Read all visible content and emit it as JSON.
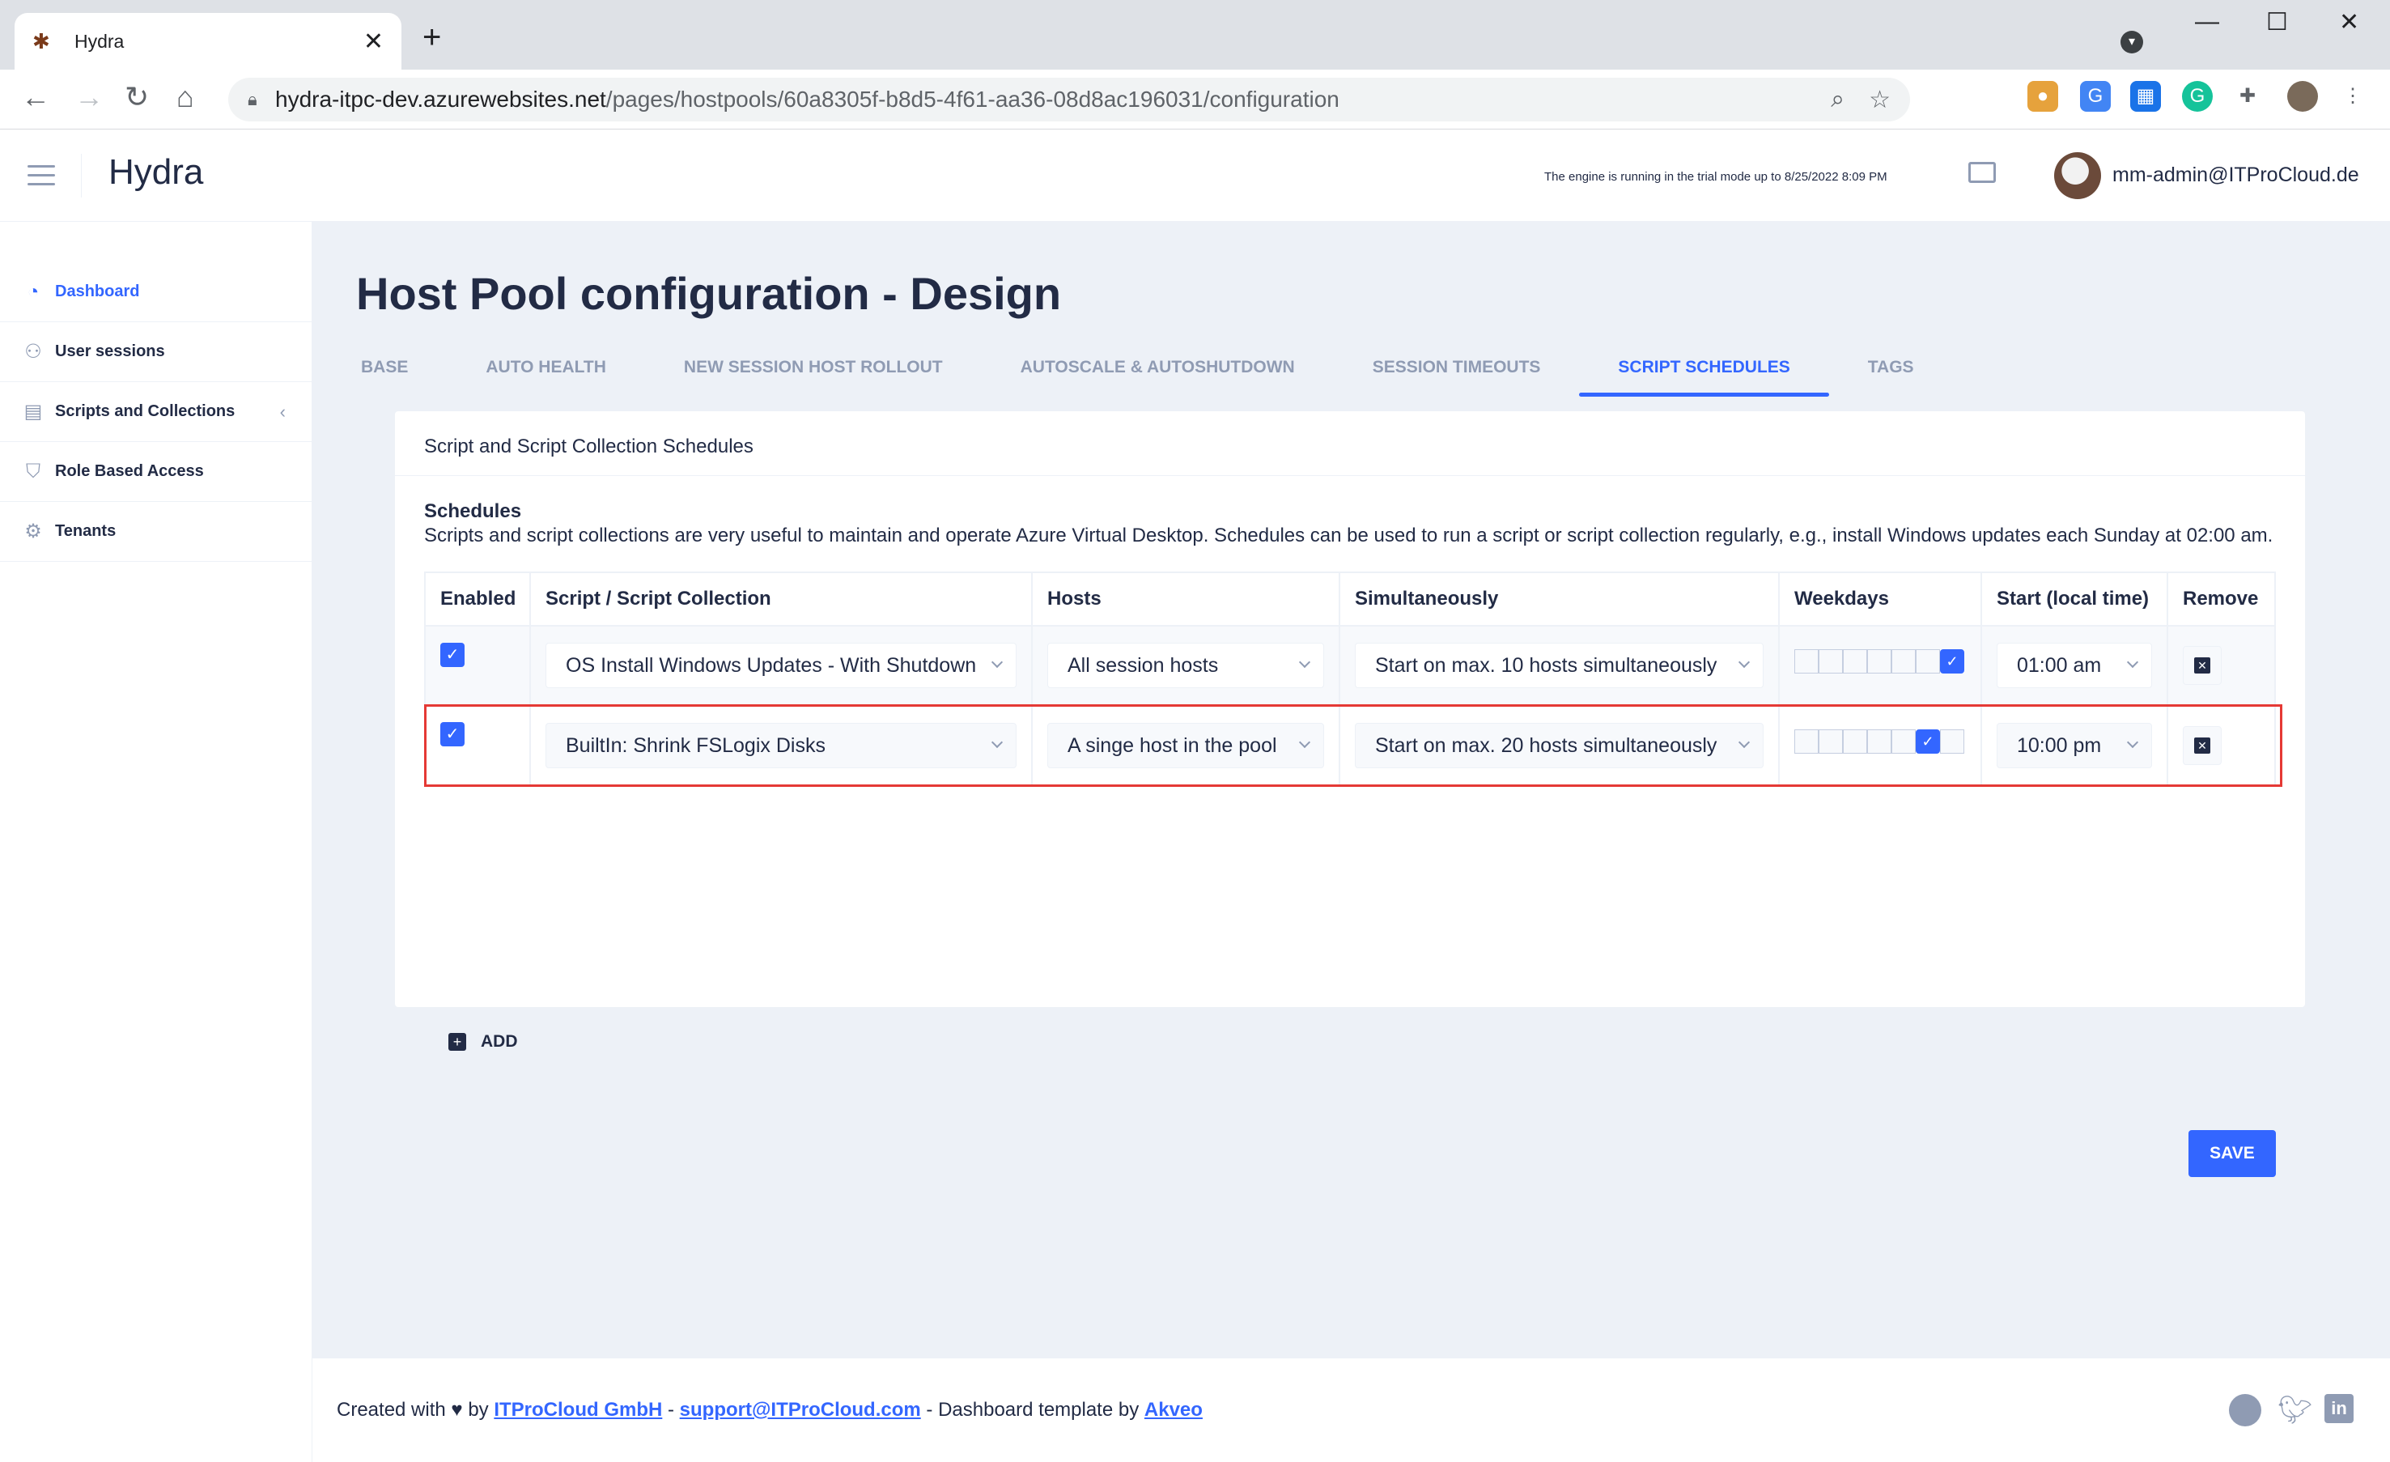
{
  "browser": {
    "tab_title": "Hydra",
    "url_host": "hydra-itpc-dev.azurewebsites.net",
    "url_path": "/pages/hostpools/60a8305f-b8d5-4f61-aa36-08d8ac196031/configuration"
  },
  "header": {
    "app_title": "Hydra",
    "trial_note": "The engine is running in the trial mode up to 8/25/2022 8:09 PM",
    "user": "mm-admin@ITProCloud.de"
  },
  "sidebar": {
    "items": [
      {
        "label": "Dashboard",
        "icon": "pie-chart-icon",
        "active": true
      },
      {
        "label": "User sessions",
        "icon": "people-icon"
      },
      {
        "label": "Scripts and Collections",
        "icon": "archive-icon"
      },
      {
        "label": "Role Based Access",
        "icon": "shield-icon"
      },
      {
        "label": "Tenants",
        "icon": "settings-icon"
      }
    ]
  },
  "page": {
    "title": "Host Pool configuration - Design",
    "tabs": [
      "BASE",
      "AUTO HEALTH",
      "NEW SESSION HOST ROLLOUT",
      "AUTOSCALE & AUTOSHUTDOWN",
      "SESSION TIMEOUTS",
      "SCRIPT SCHEDULES",
      "TAGS"
    ],
    "active_tab": "SCRIPT SCHEDULES"
  },
  "card": {
    "header": "Script and Script Collection Schedules",
    "section_title": "Schedules",
    "description": "Scripts and script collections are very useful to maintain and operate Azure Virtual Desktop. Schedules can be used to run a script or script collection regularly, e.g., install Windows updates each Sunday at 02:00 am.",
    "columns": [
      "Enabled",
      "Script / Script Collection",
      "Hosts",
      "Simultaneously",
      "Weekdays",
      "Start (local time)",
      "Remove"
    ],
    "rows": [
      {
        "enabled": true,
        "script": "OS Install Windows Updates - With Shutdown",
        "hosts": "All session hosts",
        "simultaneously": "Start on max. 10 hosts simultaneously",
        "weekdays": [
          false,
          false,
          false,
          false,
          false,
          false,
          true
        ],
        "start": "01:00 am"
      },
      {
        "enabled": true,
        "script": "BuiltIn: Shrink FSLogix Disks",
        "hosts": "A singe host in the pool",
        "simultaneously": "Start on max. 20 hosts simultaneously",
        "weekdays": [
          false,
          false,
          false,
          false,
          false,
          true,
          false
        ],
        "start": "10:00 pm"
      }
    ],
    "add_label": "ADD",
    "save_label": "SAVE"
  },
  "footer": {
    "prefix": "Created with ♥ by",
    "company": "ITProCloud GmbH",
    "sep1": "-",
    "email": "support@ITProCloud.com",
    "middle": "- Dashboard template by",
    "template_author": "Akveo"
  },
  "colors": {
    "primary": "#3366ff",
    "highlight": "#e53935",
    "background": "#edf1f7"
  }
}
